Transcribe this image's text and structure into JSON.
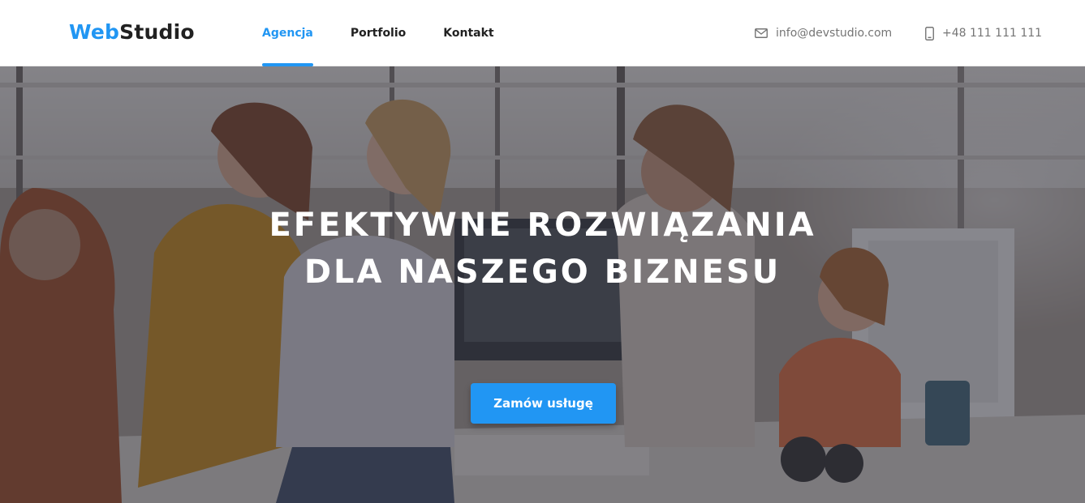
{
  "header": {
    "logo": {
      "part1": "Web",
      "part2": "Studio"
    },
    "nav": [
      {
        "label": "Agencja",
        "active": true
      },
      {
        "label": "Portfolio",
        "active": false
      },
      {
        "label": "Kontakt",
        "active": false
      }
    ],
    "email": {
      "icon": "mail-icon",
      "text": "info@devstudio.com"
    },
    "phone": {
      "icon": "phone-icon",
      "text": "+48 111 111 111"
    }
  },
  "hero": {
    "title_line1": "EFEKTYWNE ROZWIĄZANIA",
    "title_line2": "DLA NASZEGO BIZNESU",
    "cta_label": "Zamów usługę",
    "image": "office-team-photo"
  },
  "colors": {
    "accent": "#2196f3",
    "text_dark": "#212121",
    "text_muted": "#757575",
    "overlay": "#2f303a"
  }
}
